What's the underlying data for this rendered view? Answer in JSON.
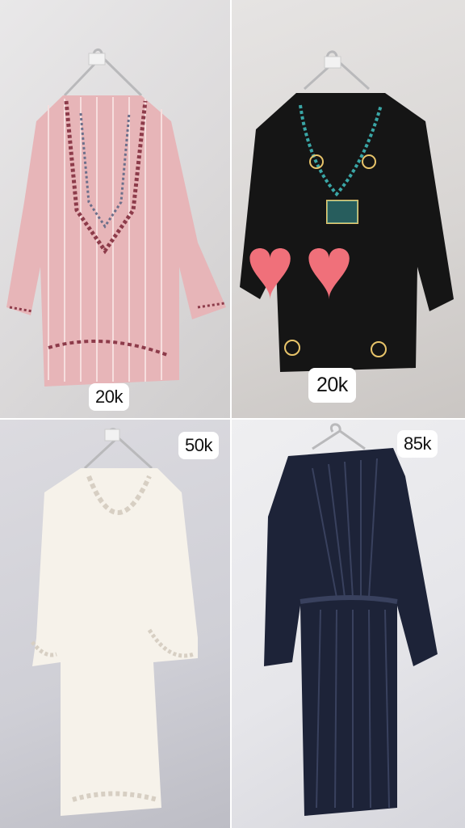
{
  "items": [
    {
      "price": "20k",
      "colors": {
        "garment": "#e7b5b8",
        "accent": "#8d3b4a"
      },
      "icon": "pink-striped-embroidered-tunic"
    },
    {
      "price": "20k",
      "colors": {
        "garment": "#151515",
        "accent": "#3aa6a6",
        "stickers": "#f0707a"
      },
      "icon": "black-embroidered-tunic"
    },
    {
      "price": "50k",
      "colors": {
        "garment": "#f6f2ea",
        "accent": "#d7cfc3"
      },
      "icon": "white-embroidered-dress"
    },
    {
      "price": "85k",
      "colors": {
        "garment": "#1d2338",
        "accent": "#39415e"
      },
      "icon": "navy-pleated-wrap-dress"
    }
  ]
}
